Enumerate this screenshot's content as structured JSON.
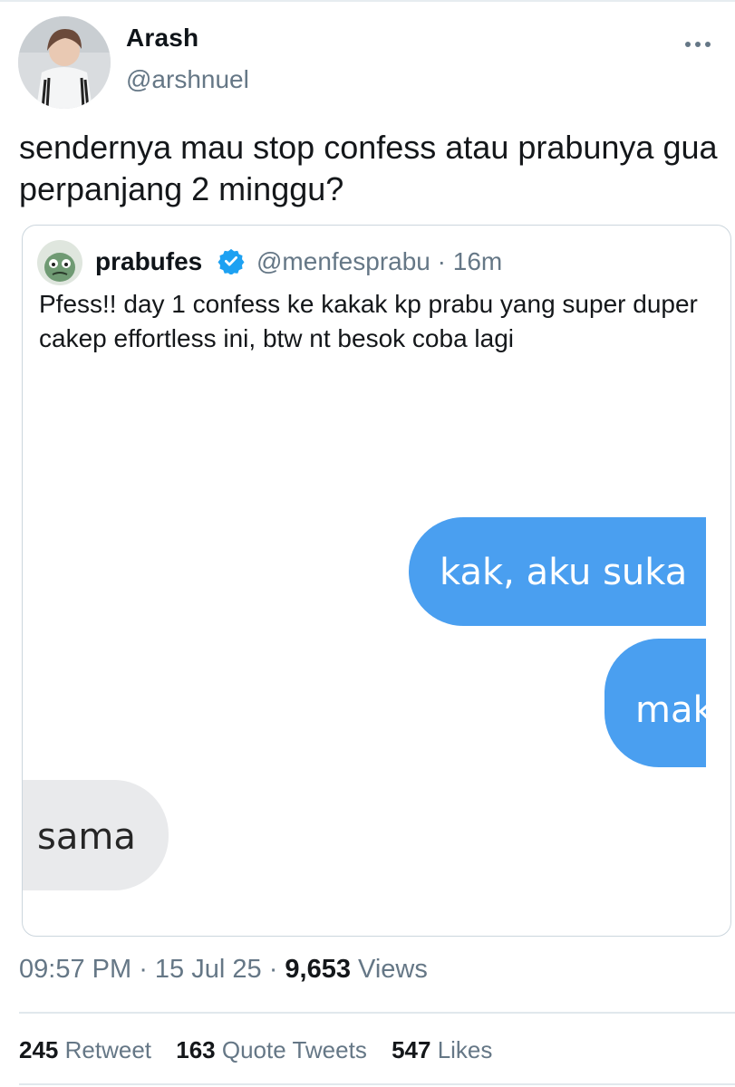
{
  "author": {
    "name": "Arash",
    "handle": "@arshnuel"
  },
  "tweet": {
    "text": "sendernya mau stop confess atau prabunya gua perpanjang 2 minggu?"
  },
  "quoted": {
    "name": "prabufes",
    "handle": "@menfesprabu",
    "time": "16m",
    "text": "Pfess!! day 1 confess ke kakak kp prabu yang super duper cakep effortless ini, btw nt besok coba lagi",
    "chat": {
      "msg1": "kak, aku suka",
      "msg2": "mak",
      "msg3": "sama"
    }
  },
  "meta": {
    "time": "09:57 PM",
    "date": "15 Jul 25",
    "views": "9,653",
    "views_label": "Views"
  },
  "stats": {
    "retweets": "245",
    "retweets_label": "Retweet",
    "quotes": "163",
    "quotes_label": "Quote Tweets",
    "likes": "547",
    "likes_label": "Likes"
  },
  "colors": {
    "accent": "#1da1f2",
    "bubble_out": "#4a9ff0",
    "bubble_in": "#e9eaec",
    "secondary_text": "#657786"
  },
  "icons": [
    "more-icon",
    "verified-badge-icon"
  ]
}
